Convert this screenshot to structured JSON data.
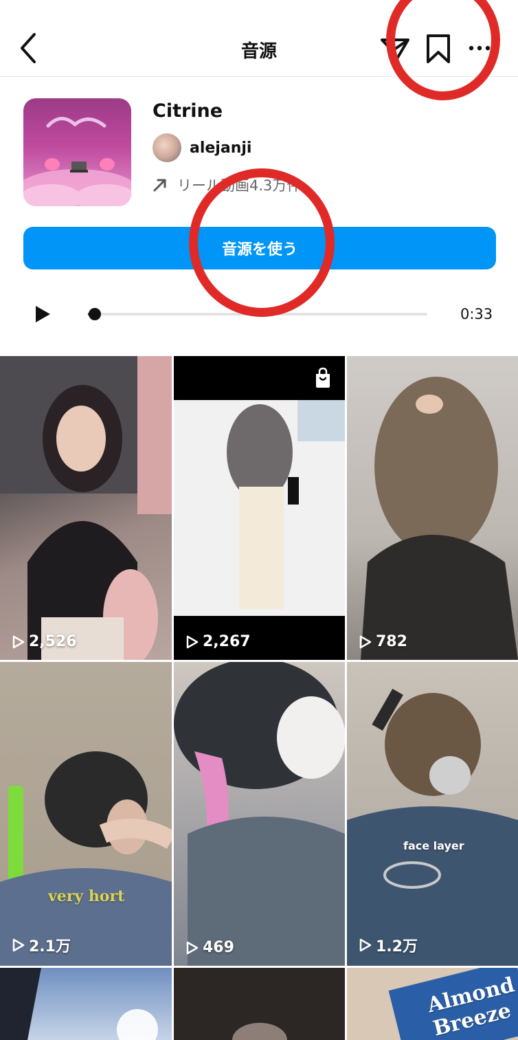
{
  "header": {
    "title": "音源"
  },
  "audio": {
    "title": "Citrine",
    "artist": "alejanji",
    "reels_count": "リール動画4.3万件",
    "use_button": "音源を使う",
    "duration": "0:33",
    "progress": 0.02
  },
  "grid": {
    "tiles": [
      {
        "count": "2,526",
        "shop": false,
        "overlay": ""
      },
      {
        "count": "2,267",
        "shop": true,
        "overlay": ""
      },
      {
        "count": "782",
        "shop": false,
        "overlay": ""
      },
      {
        "count": "2.1万",
        "shop": false,
        "overlay": "very hort"
      },
      {
        "count": "469",
        "shop": false,
        "overlay": ""
      },
      {
        "count": "1.2万",
        "shop": false,
        "overlay": "face layer"
      },
      {
        "count": "",
        "shop": false,
        "overlay": ""
      },
      {
        "count": "",
        "shop": false,
        "overlay": ""
      },
      {
        "count": "",
        "shop": false,
        "overlay": "Almond Breeze"
      }
    ]
  },
  "colors": {
    "accent": "#0095f6",
    "annotation": "#e02a27"
  }
}
